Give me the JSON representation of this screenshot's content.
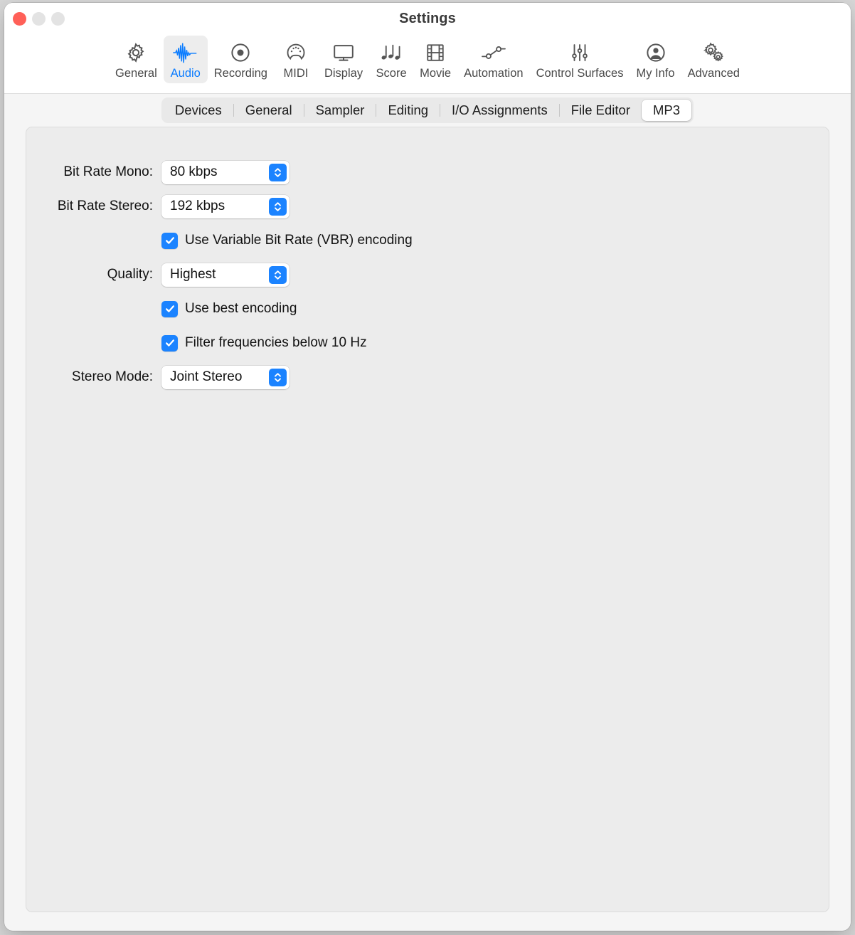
{
  "window": {
    "title": "Settings",
    "traffic_lights": [
      "close-button",
      "minimize-button",
      "zoom-button"
    ]
  },
  "toolbar": {
    "items": [
      {
        "label": "General",
        "icon": "gear-icon",
        "selected": false
      },
      {
        "label": "Audio",
        "icon": "waveform-icon",
        "selected": true
      },
      {
        "label": "Recording",
        "icon": "record-circle-icon",
        "selected": false
      },
      {
        "label": "MIDI",
        "icon": "midi-port-icon",
        "selected": false
      },
      {
        "label": "Display",
        "icon": "monitor-icon",
        "selected": false
      },
      {
        "label": "Score",
        "icon": "music-notes-icon",
        "selected": false
      },
      {
        "label": "Movie",
        "icon": "film-strip-icon",
        "selected": false
      },
      {
        "label": "Automation",
        "icon": "automation-nodes-icon",
        "selected": false
      },
      {
        "label": "Control Surfaces",
        "icon": "sliders-icon",
        "selected": false
      },
      {
        "label": "My Info",
        "icon": "person-circle-icon",
        "selected": false
      },
      {
        "label": "Advanced",
        "icon": "double-gear-icon",
        "selected": false
      }
    ],
    "accent_color": "#0a7cff",
    "selected_background": "#ededed"
  },
  "tabs": {
    "items": [
      {
        "label": "Devices",
        "active": false
      },
      {
        "label": "General",
        "active": false
      },
      {
        "label": "Sampler",
        "active": false
      },
      {
        "label": "Editing",
        "active": false
      },
      {
        "label": "I/O Assignments",
        "active": false
      },
      {
        "label": "File Editor",
        "active": false
      },
      {
        "label": "MP3",
        "active": true
      }
    ]
  },
  "form": {
    "bit_rate_mono": {
      "label": "Bit Rate Mono:",
      "value": "80 kbps"
    },
    "bit_rate_stereo": {
      "label": "Bit Rate Stereo:",
      "value": "192 kbps"
    },
    "vbr": {
      "label": "Use Variable Bit Rate (VBR) encoding",
      "checked": true
    },
    "quality": {
      "label": "Quality:",
      "value": "Highest"
    },
    "best_encoding": {
      "label": "Use best encoding",
      "checked": true
    },
    "filter_frequencies": {
      "label": "Filter frequencies below 10 Hz",
      "checked": true
    },
    "stereo_mode": {
      "label": "Stereo Mode:",
      "value": "Joint Stereo"
    }
  },
  "colors": {
    "accent_blue": "#1b83ff",
    "panel_background": "#ececec",
    "window_background": "#f5f5f5",
    "close_red": "#ff6058"
  }
}
